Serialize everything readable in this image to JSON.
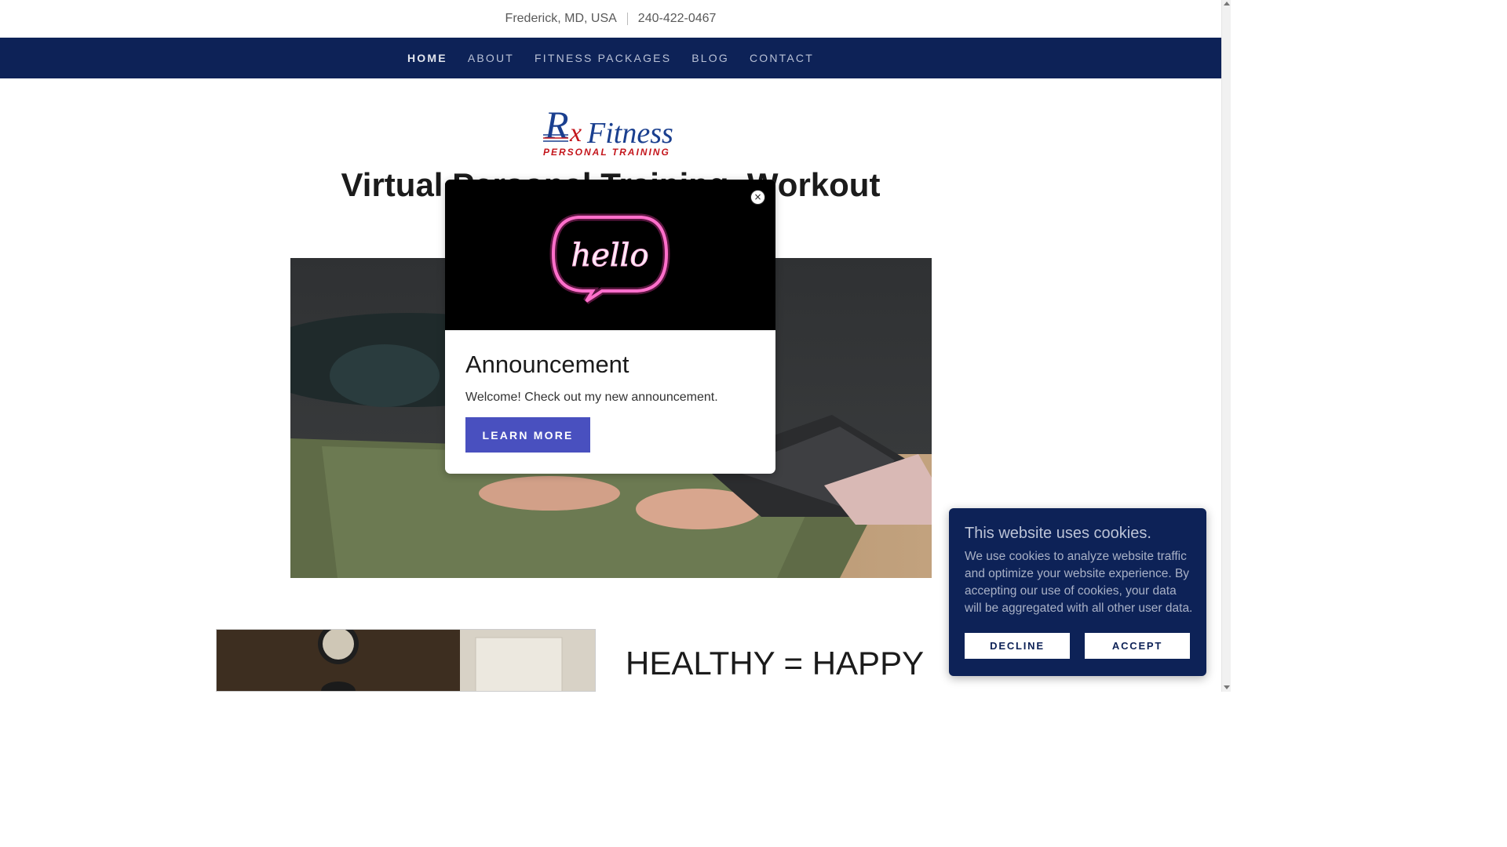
{
  "topbar": {
    "location": "Frederick, MD, USA",
    "phone": "240-422-0467"
  },
  "nav": {
    "items": [
      "HOME",
      "ABOUT",
      "FITNESS PACKAGES",
      "BLOG",
      "CONTACT"
    ],
    "active": "HOME"
  },
  "logo": {
    "text_main_1": "Rx",
    "text_main_2": "Fitness",
    "text_sub": "PERSONAL TRAINING"
  },
  "hero": {
    "title": "Virtual Personal Training, Workout"
  },
  "section": {
    "title": "HEALTHY = HAPPY"
  },
  "modal": {
    "banner_text": "hello",
    "title": "Announcement",
    "text": "Welcome! Check out my new announcement.",
    "button": "LEARN MORE",
    "close_glyph": "×"
  },
  "cookie": {
    "title": "This website uses cookies.",
    "text": "We use cookies to analyze website traffic and optimize your website experience. By accepting our use of cookies, your data will be aggregated with all other user data.",
    "decline": "DECLINE",
    "accept": "ACCEPT"
  },
  "colors": {
    "nav_bg": "#0d2257",
    "button_accent": "#4950bf",
    "neon_pink": "#ff3fb4"
  }
}
